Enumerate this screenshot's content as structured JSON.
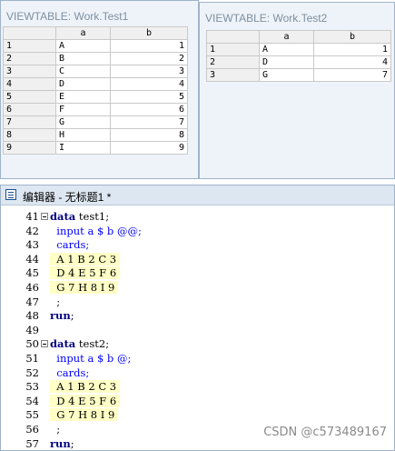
{
  "viewtable1": {
    "title": "VIEWTABLE: Work.Test1",
    "col_a": "a",
    "col_b": "b",
    "rows": [
      {
        "n": "1",
        "a": "A",
        "b": "1"
      },
      {
        "n": "2",
        "a": "B",
        "b": "2"
      },
      {
        "n": "3",
        "a": "C",
        "b": "3"
      },
      {
        "n": "4",
        "a": "D",
        "b": "4"
      },
      {
        "n": "5",
        "a": "E",
        "b": "5"
      },
      {
        "n": "6",
        "a": "F",
        "b": "6"
      },
      {
        "n": "7",
        "a": "G",
        "b": "7"
      },
      {
        "n": "8",
        "a": "H",
        "b": "8"
      },
      {
        "n": "9",
        "a": "I",
        "b": "9"
      }
    ]
  },
  "viewtable2": {
    "title": "VIEWTABLE: Work.Test2",
    "col_a": "a",
    "col_b": "b",
    "rows": [
      {
        "n": "1",
        "a": "A",
        "b": "1"
      },
      {
        "n": "2",
        "a": "D",
        "b": "4"
      },
      {
        "n": "3",
        "a": "G",
        "b": "7"
      }
    ]
  },
  "editor": {
    "title": "编辑器 - 无标题1 *",
    "lines": [
      {
        "num": "41",
        "kw": "data",
        "text": " test1;"
      },
      {
        "num": "42",
        "kw": "",
        "text": "  input a $ b @@;"
      },
      {
        "num": "43",
        "kw": "",
        "text": "  cards;"
      },
      {
        "num": "44",
        "kw": "",
        "text": "  A 1 B 2 C 3"
      },
      {
        "num": "45",
        "kw": "",
        "text": "  D 4 E 5 F 6"
      },
      {
        "num": "46",
        "kw": "",
        "text": "  G 7 H 8 I 9"
      },
      {
        "num": "47",
        "kw": "",
        "text": "  ;"
      },
      {
        "num": "48",
        "kw": "run",
        "text": ";"
      },
      {
        "num": "49",
        "kw": "",
        "text": ""
      },
      {
        "num": "50",
        "kw": "data",
        "text": " test2;"
      },
      {
        "num": "51",
        "kw": "",
        "text": "  input a $ b @;"
      },
      {
        "num": "52",
        "kw": "",
        "text": "  cards;"
      },
      {
        "num": "53",
        "kw": "",
        "text": "  A 1 B 2 C 3"
      },
      {
        "num": "54",
        "kw": "",
        "text": "  D 4 E 5 F 6"
      },
      {
        "num": "55",
        "kw": "",
        "text": "  G 7 H 8 I 9"
      },
      {
        "num": "56",
        "kw": "",
        "text": "  ;"
      },
      {
        "num": "57",
        "kw": "run",
        "text": ";"
      }
    ]
  },
  "watermark": "CSDN @c573489167",
  "colors": {
    "keyword": "#000080",
    "statement": "#0000ff",
    "cards_highlight": "#ffffc6",
    "window_title": "#7d8f9f"
  }
}
